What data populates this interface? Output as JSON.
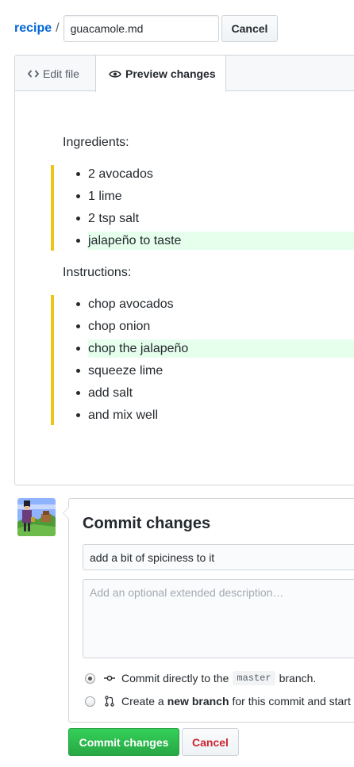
{
  "breadcrumb": {
    "repo": "recipe",
    "separator": "/",
    "filename": "guacamole.md",
    "cancel_label": "Cancel"
  },
  "tabs": {
    "edit": {
      "label": "Edit file",
      "icon": "code-icon"
    },
    "preview": {
      "label": "Preview changes",
      "icon": "eye-icon",
      "active": true
    }
  },
  "preview": {
    "ingredients_heading": "Ingredients:",
    "ingredients": [
      {
        "text": "2 avocados",
        "added": false
      },
      {
        "text": "1 lime",
        "added": false
      },
      {
        "text": "2 tsp salt",
        "added": false
      },
      {
        "text": "jalapeño to taste",
        "added": true
      }
    ],
    "instructions_heading": "Instructions:",
    "instructions": [
      {
        "text": "chop avocados",
        "added": false
      },
      {
        "text": "chop onion",
        "added": false
      },
      {
        "text": "chop the jalapeño",
        "added": true
      },
      {
        "text": "squeeze lime",
        "added": false
      },
      {
        "text": "add salt",
        "added": false
      },
      {
        "text": "and mix well",
        "added": false
      }
    ],
    "colors": {
      "changed_bar": "#f0c417",
      "added_bg": "#e6ffed"
    }
  },
  "commit": {
    "title": "Commit changes",
    "summary_value": "add a bit of spiciness to it",
    "description_placeholder": "Add an optional extended description…",
    "option_direct": {
      "prefix": "Commit directly to the",
      "branch": "master",
      "suffix": "branch.",
      "checked": true,
      "icon": "git-commit-icon"
    },
    "option_new_branch": {
      "prefix": "Create a",
      "bold": "new branch",
      "suffix": "for this commit and start a",
      "checked": false,
      "icon": "git-pull-request-icon"
    },
    "submit_label": "Commit changes",
    "cancel_label": "Cancel"
  }
}
